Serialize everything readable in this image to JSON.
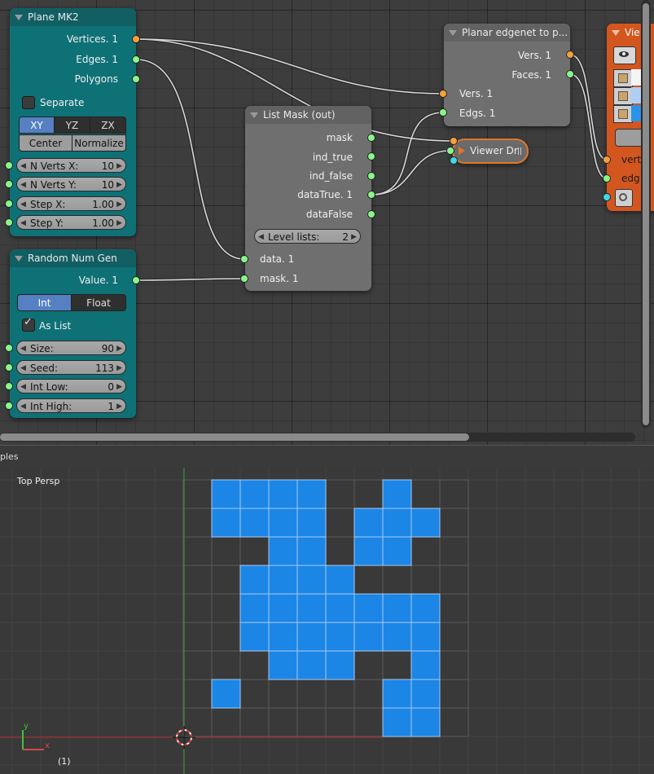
{
  "nodes": {
    "plane": {
      "title": "Plane MK2",
      "outputs": [
        "Vertices. 1",
        "Edges. 1",
        "Polygons"
      ],
      "separate_label": "Separate",
      "planes": [
        "XY",
        "YZ",
        "ZX"
      ],
      "selected_plane": "XY",
      "modes": [
        "Center",
        "Normalize"
      ],
      "fields": [
        {
          "name": "N Verts X:",
          "value": "10"
        },
        {
          "name": "N Verts Y:",
          "value": "10"
        },
        {
          "name": "Step X:",
          "value": "1.00"
        },
        {
          "name": "Step Y:",
          "value": "1.00"
        }
      ]
    },
    "random": {
      "title": "Random Num Gen",
      "output": "Value. 1",
      "types": [
        "Int",
        "Float"
      ],
      "selected_type": "Int",
      "as_list_label": "As List",
      "as_list_checked": true,
      "fields": [
        {
          "name": "Size:",
          "value": "90"
        },
        {
          "name": "Seed:",
          "value": "113"
        },
        {
          "name": "Int Low:",
          "value": "0"
        },
        {
          "name": "Int High:",
          "value": "1"
        }
      ]
    },
    "listmask": {
      "title": "List Mask (out)",
      "outputs": [
        "mask",
        "ind_true",
        "ind_false",
        "dataTrue. 1",
        "dataFalse"
      ],
      "level_label": "Level lists:",
      "level_value": "2",
      "inputs": [
        "data. 1",
        "mask. 1"
      ]
    },
    "planar": {
      "title": "Planar edgenet to p...",
      "outputs": [
        "Vers. 1",
        "Faces. 1"
      ],
      "inputs": [
        "Vers. 1",
        "Edgs. 1"
      ]
    },
    "viewer_draw": {
      "title": "Viewer Dr"
    },
    "viewer": {
      "title": "Vie",
      "inputs": [
        "vert",
        "edg"
      ]
    }
  },
  "divider_label": "ples",
  "viewport": {
    "label": "Top Persp",
    "frame": "(1)",
    "axis_x": "x",
    "axis_y": "y",
    "cells": [
      [
        0,
        0
      ],
      [
        1,
        0
      ],
      [
        2,
        0
      ],
      [
        3,
        0
      ],
      [
        6,
        0
      ],
      [
        0,
        1
      ],
      [
        1,
        1
      ],
      [
        2,
        1
      ],
      [
        3,
        1
      ],
      [
        5,
        1
      ],
      [
        6,
        1
      ],
      [
        7,
        1
      ],
      [
        2,
        2
      ],
      [
        3,
        2
      ],
      [
        5,
        2
      ],
      [
        6,
        2
      ],
      [
        1,
        3
      ],
      [
        2,
        3
      ],
      [
        3,
        3
      ],
      [
        4,
        3
      ],
      [
        1,
        4
      ],
      [
        2,
        4
      ],
      [
        3,
        4
      ],
      [
        4,
        4
      ],
      [
        5,
        4
      ],
      [
        6,
        4
      ],
      [
        7,
        4
      ],
      [
        1,
        5
      ],
      [
        2,
        5
      ],
      [
        3,
        5
      ],
      [
        4,
        5
      ],
      [
        5,
        5
      ],
      [
        6,
        5
      ],
      [
        7,
        5
      ],
      [
        2,
        6
      ],
      [
        3,
        6
      ],
      [
        4,
        6
      ],
      [
        7,
        6
      ],
      [
        6,
        7
      ],
      [
        7,
        7
      ],
      [
        0,
        7
      ],
      [
        6,
        8
      ],
      [
        7,
        8
      ]
    ],
    "colors": {
      "face": "#1b86e6",
      "edge": "#a9c9f2",
      "grid": "#5a5a5a",
      "axis_x": "#b22a2a",
      "axis_y": "#3a9a3a"
    }
  }
}
